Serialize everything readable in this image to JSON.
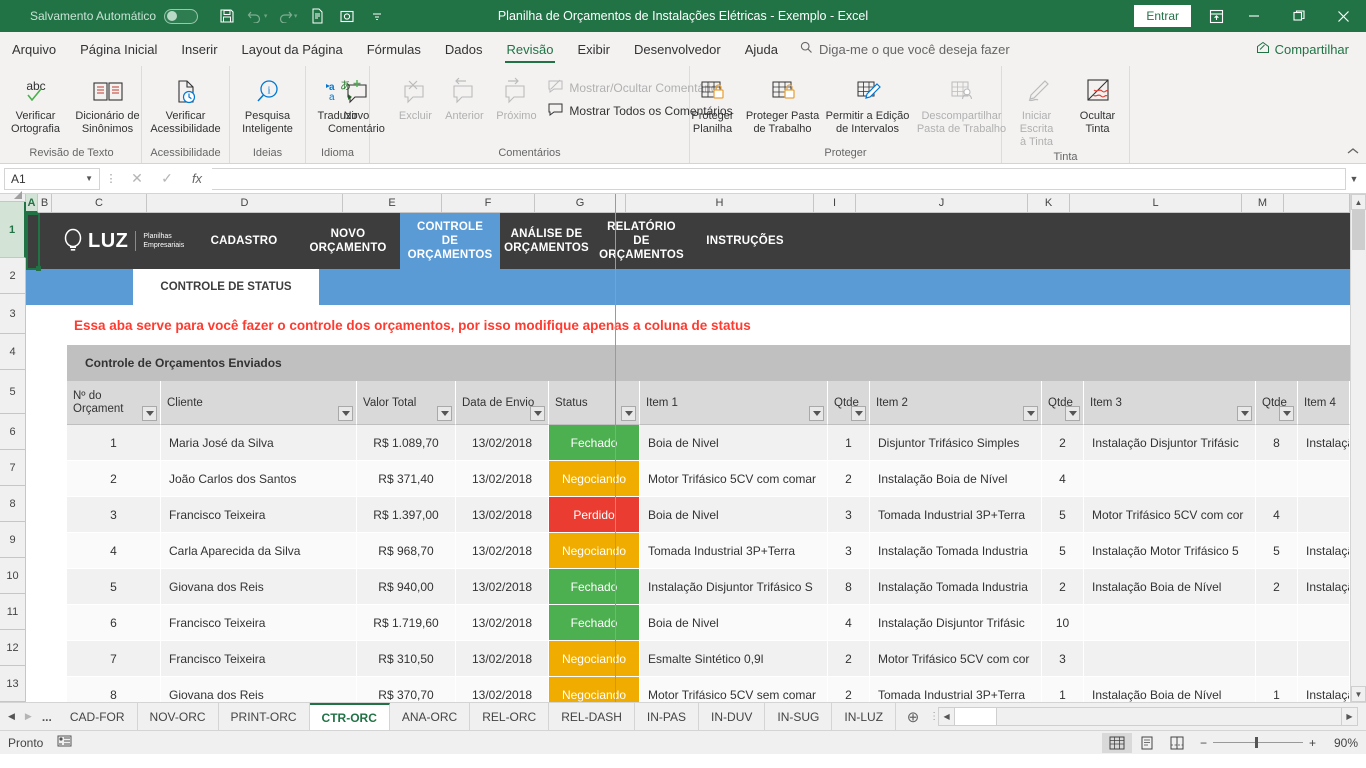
{
  "titlebar": {
    "autosave_label": "Salvamento Automático",
    "autosave_state": "off",
    "document_title": "Planilha de Orçamentos de Instalações Elétricas - Exemplo  -  Excel",
    "signin_label": "Entrar",
    "accent_color": "#217346"
  },
  "ribbon_tabs": [
    {
      "label": "Arquivo",
      "active": false
    },
    {
      "label": "Página Inicial",
      "active": false
    },
    {
      "label": "Inserir",
      "active": false
    },
    {
      "label": "Layout da Página",
      "active": false
    },
    {
      "label": "Fórmulas",
      "active": false
    },
    {
      "label": "Dados",
      "active": false
    },
    {
      "label": "Revisão",
      "active": true
    },
    {
      "label": "Exibir",
      "active": false
    },
    {
      "label": "Desenvolvedor",
      "active": false
    },
    {
      "label": "Ajuda",
      "active": false
    }
  ],
  "tellme": {
    "placeholder": "Diga-me o que você deseja fazer"
  },
  "share": {
    "label": "Compartilhar"
  },
  "ribbon": {
    "groups": [
      {
        "label": "Revisão de Texto",
        "buttons": [
          {
            "label_line1": "Verificar",
            "label_line2": "Ortografia",
            "icon": "spellcheck-icon",
            "disabled": false
          },
          {
            "label_line1": "Dicionário de",
            "label_line2": "Sinônimos",
            "icon": "thesaurus-icon",
            "disabled": false
          }
        ]
      },
      {
        "label": "Acessibilidade",
        "buttons": [
          {
            "label_line1": "Verificar",
            "label_line2": "Acessibilidade",
            "icon": "accessibility-check-icon",
            "disabled": false
          }
        ]
      },
      {
        "label": "Ideias",
        "buttons": [
          {
            "label_line1": "Pesquisa",
            "label_line2": "Inteligente",
            "icon": "smart-lookup-icon",
            "disabled": false
          }
        ]
      },
      {
        "label": "Idioma",
        "buttons": [
          {
            "label_line1": "Traduzir",
            "label_line2": "",
            "icon": "translate-icon",
            "disabled": false
          }
        ]
      },
      {
        "label": "Comentários",
        "buttons": [
          {
            "label_line1": "Novo",
            "label_line2": "Comentário",
            "icon": "new-comment-icon",
            "disabled": false
          },
          {
            "label_line1": "Excluir",
            "label_line2": "",
            "icon": "delete-comment-icon",
            "disabled": true
          },
          {
            "label_line1": "Anterior",
            "label_line2": "",
            "icon": "previous-comment-icon",
            "disabled": true
          },
          {
            "label_line1": "Próximo",
            "label_line2": "",
            "icon": "next-comment-icon",
            "disabled": true
          }
        ],
        "small_buttons": [
          {
            "label": "Mostrar/Ocultar Comentário",
            "icon": "show-hide-comment-icon",
            "disabled": true
          },
          {
            "label": "Mostrar Todos os Comentários",
            "icon": "show-all-comments-icon",
            "disabled": false
          }
        ]
      },
      {
        "label": "Proteger",
        "buttons": [
          {
            "label_line1": "Proteger",
            "label_line2": "Planilha",
            "icon": "protect-sheet-icon",
            "disabled": false
          },
          {
            "label_line1": "Proteger Pasta",
            "label_line2": "de Trabalho",
            "icon": "protect-workbook-icon",
            "disabled": false
          },
          {
            "label_line1": "Permitir a Edição",
            "label_line2": "de Intervalos",
            "icon": "allow-edit-ranges-icon",
            "disabled": false
          },
          {
            "label_line1": "Descompartilhar",
            "label_line2": "Pasta de Trabalho",
            "icon": "unshare-workbook-icon",
            "disabled": true
          }
        ]
      },
      {
        "label": "Tinta",
        "buttons": [
          {
            "label_line1": "Iniciar Escrita",
            "label_line2": "à Tinta",
            "icon": "start-inking-icon",
            "disabled": true
          },
          {
            "label_line1": "Ocultar",
            "label_line2": "Tinta",
            "icon": "hide-ink-icon",
            "disabled": false
          }
        ]
      }
    ]
  },
  "formula_bar": {
    "name_box": "A1",
    "formula_value": "",
    "cancel_icon": "cancel-icon",
    "confirm_icon": "confirm-icon",
    "fx_icon": "insert-function-icon"
  },
  "grid": {
    "column_headers": [
      "A",
      "B",
      "C",
      "D",
      "E",
      "F",
      "G",
      "H",
      "I",
      "J",
      "K",
      "L",
      "M"
    ],
    "selected_column": "A",
    "row_headers": [
      "1",
      "2",
      "3",
      "4",
      "5",
      "6",
      "7",
      "8",
      "9",
      "10",
      "11",
      "12",
      "13"
    ],
    "selected_row": "1",
    "selected_cell": "A1"
  },
  "banner": {
    "logo_text": "LUZ",
    "logo_sub_line1": "Planilhas",
    "logo_sub_line2": "Empresariais",
    "nav_items": [
      {
        "label": "CADASTRO",
        "active": false
      },
      {
        "label": "NOVO ORÇAMENTO",
        "active": false
      },
      {
        "label": "CONTROLE DE ORÇAMENTOS",
        "active": true
      },
      {
        "label": "ANÁLISE DE ORÇAMENTOS",
        "active": false
      },
      {
        "label": "RELATÓRIO DE ORÇAMENTOS",
        "active": false
      },
      {
        "label": "INSTRUÇÕES",
        "active": false
      }
    ],
    "nav_bg": "#3d3d3d",
    "nav_active_bg": "#5b9bd5",
    "subtab_label": "CONTROLE DE STATUS",
    "subbar_bg": "#5b9bd5"
  },
  "sheet": {
    "instruction_text": "Essa aba serve para você fazer o controle dos orçamentos, por isso modifique apenas a coluna de status",
    "instruction_color": "#ff3b30",
    "table_caption": "Controle de Orçamentos Enviados",
    "headers": [
      "Nº do Orçament",
      "Cliente",
      "Valor Total",
      "Data de Envio",
      "Status",
      "Item 1",
      "Qtde",
      "Item 2",
      "Qtde",
      "Item 3",
      "Qtde",
      "Item 4"
    ],
    "status_colors": {
      "Fechado": "#4caf50",
      "Negociando": "#f0ad00",
      "Perdido": "#eb3c32"
    },
    "rows": [
      {
        "num": "1",
        "cliente": "Maria José da Silva",
        "valor": "R$ 1.089,70",
        "data": "13/02/2018",
        "status": "Fechado",
        "item1": "Boia de Nivel",
        "qtde1": "1",
        "item2": "Disjuntor Trifásico Simples",
        "qtde2": "2",
        "item3": "Instalação Disjuntor Trifásic",
        "qtde3": "8",
        "item4": "Instalaçã"
      },
      {
        "num": "2",
        "cliente": "João Carlos dos Santos",
        "valor": "R$ 371,40",
        "data": "13/02/2018",
        "status": "Negociando",
        "item1": "Motor Trifásico 5CV com comar",
        "qtde1": "2",
        "item2": "Instalação Boia de Nível",
        "qtde2": "4",
        "item3": "",
        "qtde3": "",
        "item4": ""
      },
      {
        "num": "3",
        "cliente": "Francisco Teixeira",
        "valor": "R$ 1.397,00",
        "data": "13/02/2018",
        "status": "Perdido",
        "item1": "Boia de Nivel",
        "qtde1": "3",
        "item2": "Tomada Industrial 3P+Terra",
        "qtde2": "5",
        "item3": "Motor Trifásico 5CV com cor",
        "qtde3": "4",
        "item4": ""
      },
      {
        "num": "4",
        "cliente": "Carla Aparecida da Silva",
        "valor": "R$ 968,70",
        "data": "13/02/2018",
        "status": "Negociando",
        "item1": "Tomada Industrial 3P+Terra",
        "qtde1": "3",
        "item2": "Instalação Tomada Industria",
        "qtde2": "5",
        "item3": "Instalação Motor Trifásico 5",
        "qtde3": "5",
        "item4": "Instalaçã"
      },
      {
        "num": "5",
        "cliente": "Giovana dos Reis",
        "valor": "R$ 940,00",
        "data": "13/02/2018",
        "status": "Fechado",
        "item1": "Instalação Disjuntor Trifásico S",
        "qtde1": "8",
        "item2": "Instalação Tomada Industria",
        "qtde2": "2",
        "item3": "Instalação Boia de Nível",
        "qtde3": "2",
        "item4": "Instalaçã"
      },
      {
        "num": "6",
        "cliente": "Francisco Teixeira",
        "valor": "R$ 1.719,60",
        "data": "13/02/2018",
        "status": "Fechado",
        "item1": "Boia de Nivel",
        "qtde1": "4",
        "item2": "Instalação Disjuntor Trifásic",
        "qtde2": "10",
        "item3": "",
        "qtde3": "",
        "item4": ""
      },
      {
        "num": "7",
        "cliente": "Francisco Teixeira",
        "valor": "R$ 310,50",
        "data": "13/02/2018",
        "status": "Negociando",
        "item1": "Esmalte Sintético 0,9l",
        "qtde1": "2",
        "item2": "Motor Trifásico 5CV com cor",
        "qtde2": "3",
        "item3": "",
        "qtde3": "",
        "item4": ""
      },
      {
        "num": "8",
        "cliente": "Giovana dos Reis",
        "valor": "R$ 370,70",
        "data": "13/02/2018",
        "status": "Negociando",
        "item1": "Motor Trifásico 5CV sem comar",
        "qtde1": "2",
        "item2": "Tomada Industrial 3P+Terra",
        "qtde2": "1",
        "item3": "Instalação Boia de Nível",
        "qtde3": "1",
        "item4": "Instalaçã"
      }
    ]
  },
  "sheet_tabs": {
    "ellipsis": "...",
    "tabs": [
      {
        "label": "CAD-FOR",
        "active": false
      },
      {
        "label": "NOV-ORC",
        "active": false
      },
      {
        "label": "PRINT-ORC",
        "active": false
      },
      {
        "label": "CTR-ORC",
        "active": true
      },
      {
        "label": "ANA-ORC",
        "active": false
      },
      {
        "label": "REL-ORC",
        "active": false
      },
      {
        "label": "REL-DASH",
        "active": false
      },
      {
        "label": "IN-PAS",
        "active": false
      },
      {
        "label": "IN-DUV",
        "active": false
      },
      {
        "label": "IN-SUG",
        "active": false
      },
      {
        "label": "IN-LUZ",
        "active": false
      }
    ]
  },
  "statusbar": {
    "mode": "Pronto",
    "macro_icon": "record-macro-icon",
    "views": [
      {
        "name": "normal-view",
        "active": true
      },
      {
        "name": "page-layout-view",
        "active": false
      },
      {
        "name": "page-break-view",
        "active": false
      }
    ],
    "zoom_out": "−",
    "zoom_in": "+",
    "zoom_level": "90%"
  }
}
